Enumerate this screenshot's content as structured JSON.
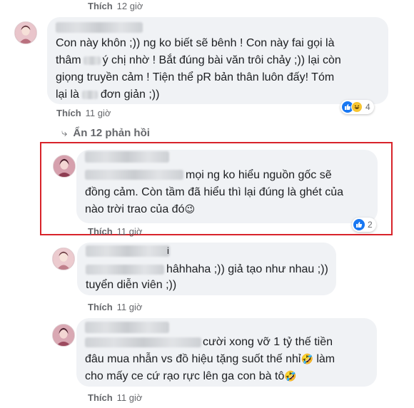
{
  "top_meta": {
    "action": "Thích",
    "time": "12 giờ"
  },
  "comments": [
    {
      "lines": [
        "Con này khôn ;)) ng ko biết sẽ bênh ! Con này fai gọi là",
        "ý chị nhờ ! Bắt đúng bài văn trôi chảy ;)) lại còn",
        "giọng truyền cảm ! Tiện thể pR bản thân luôn đấy! Tóm",
        "đơn giản ;))"
      ],
      "line2_prefix": "thâm",
      "line4_prefix": "lại là",
      "action": "Thích",
      "time": "11 giờ",
      "reaction_count": "4"
    }
  ],
  "hide_replies": {
    "arrow": "⤷",
    "label": "Ẩn 12 phản hồi"
  },
  "replies": [
    {
      "lines": [
        "mọi ng ko hiểu nguồn gốc sẽ",
        "đồng cảm. Còn tầm đã hiểu thì lại đúng là ghét của",
        "nào trời trao của đó"
      ],
      "emoji": "😉",
      "action": "Thích",
      "time": "11 giờ",
      "reaction_count": "2",
      "highlighted": true
    },
    {
      "line1_tail": "i",
      "lines": [
        "hâhhaha ;)) giả tạo như nhau ;))",
        "tuyển diễn viên ;))"
      ],
      "action": "Thích",
      "time": "11 giờ"
    },
    {
      "lines": [
        "cười xong vỡ 1 tỷ thế tiền",
        "đâu mua nhẫn vs đồ hiệu tặng suốt thế nhỉ",
        "làm",
        "cho mấy ce cứ rạo rực lên ga con bà tô"
      ],
      "emoji": "🤣",
      "action": "Thích",
      "time": "11 giờ"
    }
  ],
  "colors": {
    "highlight_border": "#d8232a",
    "like_blue": "#1877f2",
    "bubble_bg": "#f0f2f5"
  },
  "icons": [
    "like-icon",
    "haha-icon",
    "reply-arrow-icon"
  ]
}
